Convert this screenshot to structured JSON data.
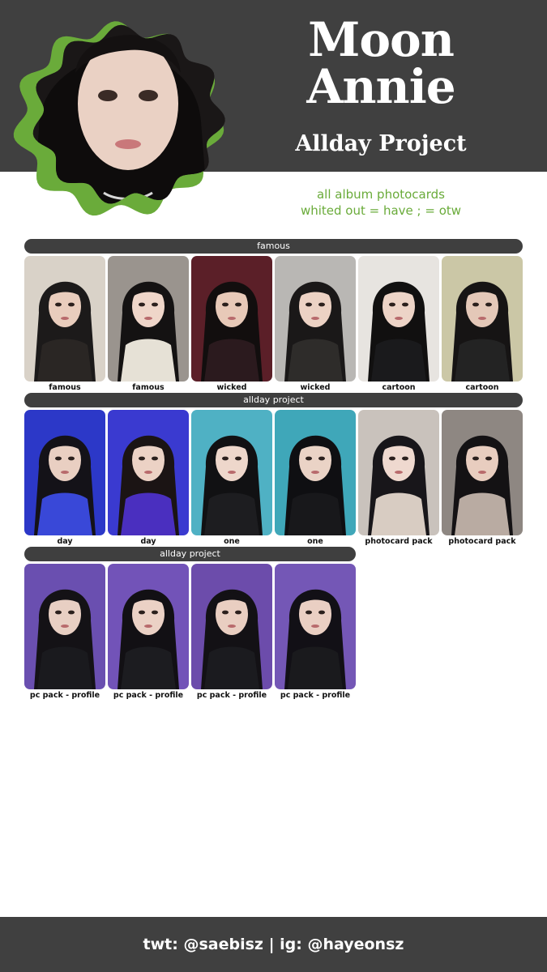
{
  "header": {
    "name_first": "Moon",
    "name_last": "Annie",
    "group": "Allday Project",
    "subtitle_line1": "all album photocards",
    "subtitle_line2": "whited out = have ;      = otw"
  },
  "colors": {
    "header_bg": "#404040",
    "accent_green": "#6aab3a",
    "section_bar": "#3f3f3f",
    "footer_bg": "#404040"
  },
  "sections": [
    {
      "title": "famous",
      "cards": [
        {
          "label": "famous",
          "bg": "#d9d2c8",
          "hair": "#1c1a1a",
          "top": "#2a2624",
          "skin": "#e9cdbd"
        },
        {
          "label": "famous",
          "bg": "#9a948e",
          "hair": "#141212",
          "top": "#e6e1d6",
          "skin": "#efd6c9"
        },
        {
          "label": "wicked",
          "bg": "#5b1f28",
          "hair": "#120e0e",
          "top": "#2b1a1e",
          "skin": "#e8c9b8"
        },
        {
          "label": "wicked",
          "bg": "#b9b7b4",
          "hair": "#1a1818",
          "top": "#2e2c2a",
          "skin": "#ecd2c4"
        },
        {
          "label": "cartoon",
          "bg": "#e7e4e0",
          "hair": "#111010",
          "top": "#1a1a1c",
          "skin": "#edd4c7"
        },
        {
          "label": "cartoon",
          "bg": "#cbc7a6",
          "hair": "#161414",
          "top": "#232323",
          "skin": "#e4c8b8"
        }
      ]
    },
    {
      "title": "allday project",
      "cards": [
        {
          "label": "day",
          "bg": "#2c38c8",
          "hair": "#141218",
          "top": "#3948d8",
          "skin": "#e9cfc2"
        },
        {
          "label": "day",
          "bg": "#3a3ad0",
          "hair": "#1b1414",
          "top": "#4a2fbf",
          "skin": "#ecd2c5"
        },
        {
          "label": "one",
          "bg": "#4fb1c4",
          "hair": "#111113",
          "top": "#1d1d20",
          "skin": "#eed7cb"
        },
        {
          "label": "one",
          "bg": "#3fa7b9",
          "hair": "#0f0f12",
          "top": "#18181b",
          "skin": "#ead3c6"
        },
        {
          "label": "photocard pack",
          "bg": "#c9c2bc",
          "hair": "#18161a",
          "top": "#d8ccc2",
          "skin": "#efd9cf"
        },
        {
          "label": "photocard pack",
          "bg": "#8e8782",
          "hair": "#141214",
          "top": "#b9aba2",
          "skin": "#e8cdbf"
        }
      ]
    },
    {
      "title": "allday project",
      "cards": [
        {
          "label": "pc pack - profile",
          "bg": "#6a4fb0",
          "hair": "#141216",
          "top": "#1a1a1e",
          "skin": "#e8cfc3"
        },
        {
          "label": "pc pack - profile",
          "bg": "#7253b8",
          "hair": "#121014",
          "top": "#1c1c20",
          "skin": "#ebd1c5"
        },
        {
          "label": "pc pack - profile",
          "bg": "#6c4cab",
          "hair": "#131115",
          "top": "#1b1b1f",
          "skin": "#e9cec1"
        },
        {
          "label": "pc pack - profile",
          "bg": "#7457b6",
          "hair": "#121016",
          "top": "#1a1a1d",
          "skin": "#eacfc3"
        }
      ]
    }
  ],
  "footer": {
    "text": "twt: @saebisz  | ig: @hayeonsz"
  }
}
